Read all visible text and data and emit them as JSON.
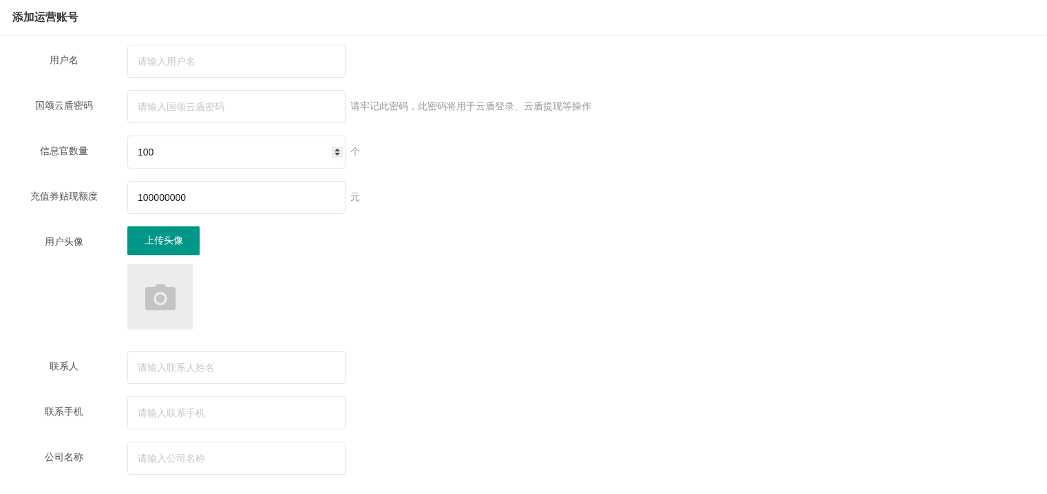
{
  "page": {
    "title": "添加运营账号"
  },
  "fields": [
    {
      "kind": "text",
      "label": "用户名",
      "placeholder": "请输入用户名"
    },
    {
      "kind": "text",
      "label": "国颂云盾密码",
      "placeholder": "请输入国颂云盾密码",
      "hint": "请牢记此密码，此密码将用于云盾登录、云盾提现等操作"
    },
    {
      "kind": "number",
      "label": "信息官数量",
      "value": "100",
      "suffix": "个"
    },
    {
      "kind": "text",
      "label": "充值券贴现额度",
      "value": "100000000",
      "suffix": "元"
    },
    {
      "kind": "upload",
      "label": "用户头像",
      "button": "上传头像"
    },
    {
      "kind": "text",
      "label": "联系人",
      "placeholder": "请输入联系人姓名"
    },
    {
      "kind": "text",
      "label": "联系手机",
      "placeholder": "请输入联系手机"
    },
    {
      "kind": "text",
      "label": "公司名称",
      "placeholder": "请输入公司名称"
    }
  ]
}
